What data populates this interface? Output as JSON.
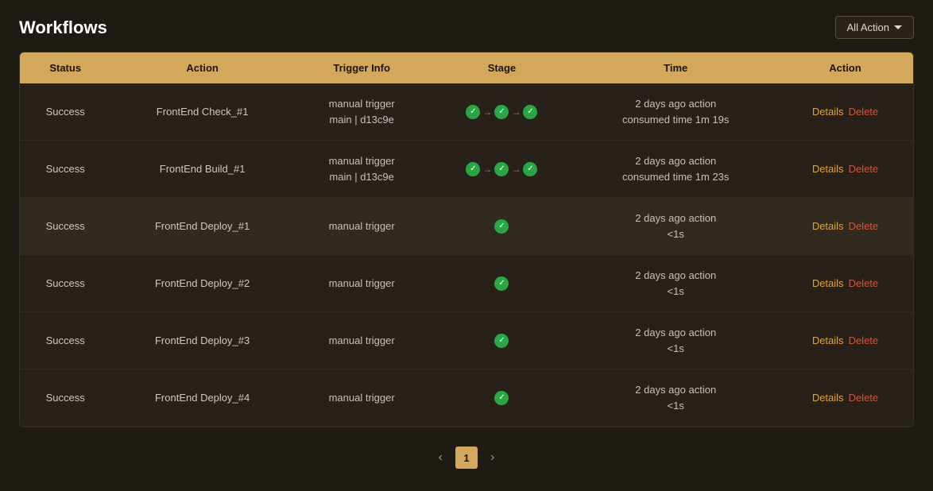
{
  "header": {
    "title": "Workflows",
    "filter_button": "All Action"
  },
  "table": {
    "columns": [
      "Status",
      "Action",
      "Trigger Info",
      "Stage",
      "Time",
      "Action"
    ],
    "rows": [
      {
        "status": "Success",
        "action": "FrontEnd Check_#1",
        "trigger_info_line1": "manual trigger",
        "trigger_info_line2": "main | d13c9e",
        "stage_type": "multi",
        "time_line1": "2 days ago action",
        "time_line2": "consumed time 1m 19s",
        "details": "Details",
        "delete": "Delete"
      },
      {
        "status": "Success",
        "action": "FrontEnd Build_#1",
        "trigger_info_line1": "manual trigger",
        "trigger_info_line2": "main | d13c9e",
        "stage_type": "multi",
        "time_line1": "2 days ago action",
        "time_line2": "consumed time 1m 23s",
        "details": "Details",
        "delete": "Delete"
      },
      {
        "status": "Success",
        "action": "FrontEnd Deploy_#1",
        "trigger_info_line1": "manual trigger",
        "trigger_info_line2": "",
        "stage_type": "single",
        "time_line1": "2 days ago action",
        "time_line2": "<1s",
        "details": "Details",
        "delete": "Delete"
      },
      {
        "status": "Success",
        "action": "FrontEnd Deploy_#2",
        "trigger_info_line1": "manual trigger",
        "trigger_info_line2": "",
        "stage_type": "single",
        "time_line1": "2 days ago action",
        "time_line2": "<1s",
        "details": "Details",
        "delete": "Delete"
      },
      {
        "status": "Success",
        "action": "FrontEnd Deploy_#3",
        "trigger_info_line1": "manual trigger",
        "trigger_info_line2": "",
        "stage_type": "single",
        "time_line1": "2 days ago action",
        "time_line2": "<1s",
        "details": "Details",
        "delete": "Delete"
      },
      {
        "status": "Success",
        "action": "FrontEnd Deploy_#4",
        "trigger_info_line1": "manual trigger",
        "trigger_info_line2": "",
        "stage_type": "single",
        "time_line1": "2 days ago action",
        "time_line2": "<1s",
        "details": "Details",
        "delete": "Delete"
      }
    ]
  },
  "pagination": {
    "current_page": "1",
    "prev": "‹",
    "next": "›"
  }
}
